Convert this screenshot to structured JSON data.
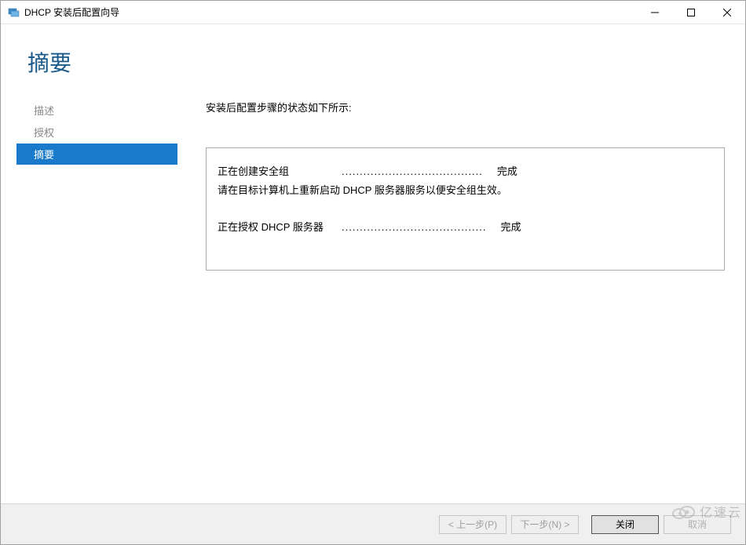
{
  "window": {
    "title": "DHCP 安装后配置向导"
  },
  "header": {
    "title": "摘要"
  },
  "sidebar": {
    "items": [
      {
        "label": "描述",
        "active": false
      },
      {
        "label": "授权",
        "active": false
      },
      {
        "label": "摘要",
        "active": true
      }
    ]
  },
  "content": {
    "intro": "安装后配置步骤的状态如下所示:",
    "status": {
      "row1_task": "正在创建安全组",
      "row1_dots": ".......................................",
      "row1_result": "完成",
      "note": "请在目标计算机上重新启动 DHCP 服务器服务以便安全组生效。",
      "row2_task": "正在授权 DHCP 服务器",
      "row2_dots": "........................................",
      "row2_result": "完成"
    }
  },
  "footer": {
    "prev": "< 上一步(P)",
    "next": "下一步(N) >",
    "close": "关闭",
    "cancel": "取消"
  },
  "watermark": {
    "text": "亿速云"
  }
}
